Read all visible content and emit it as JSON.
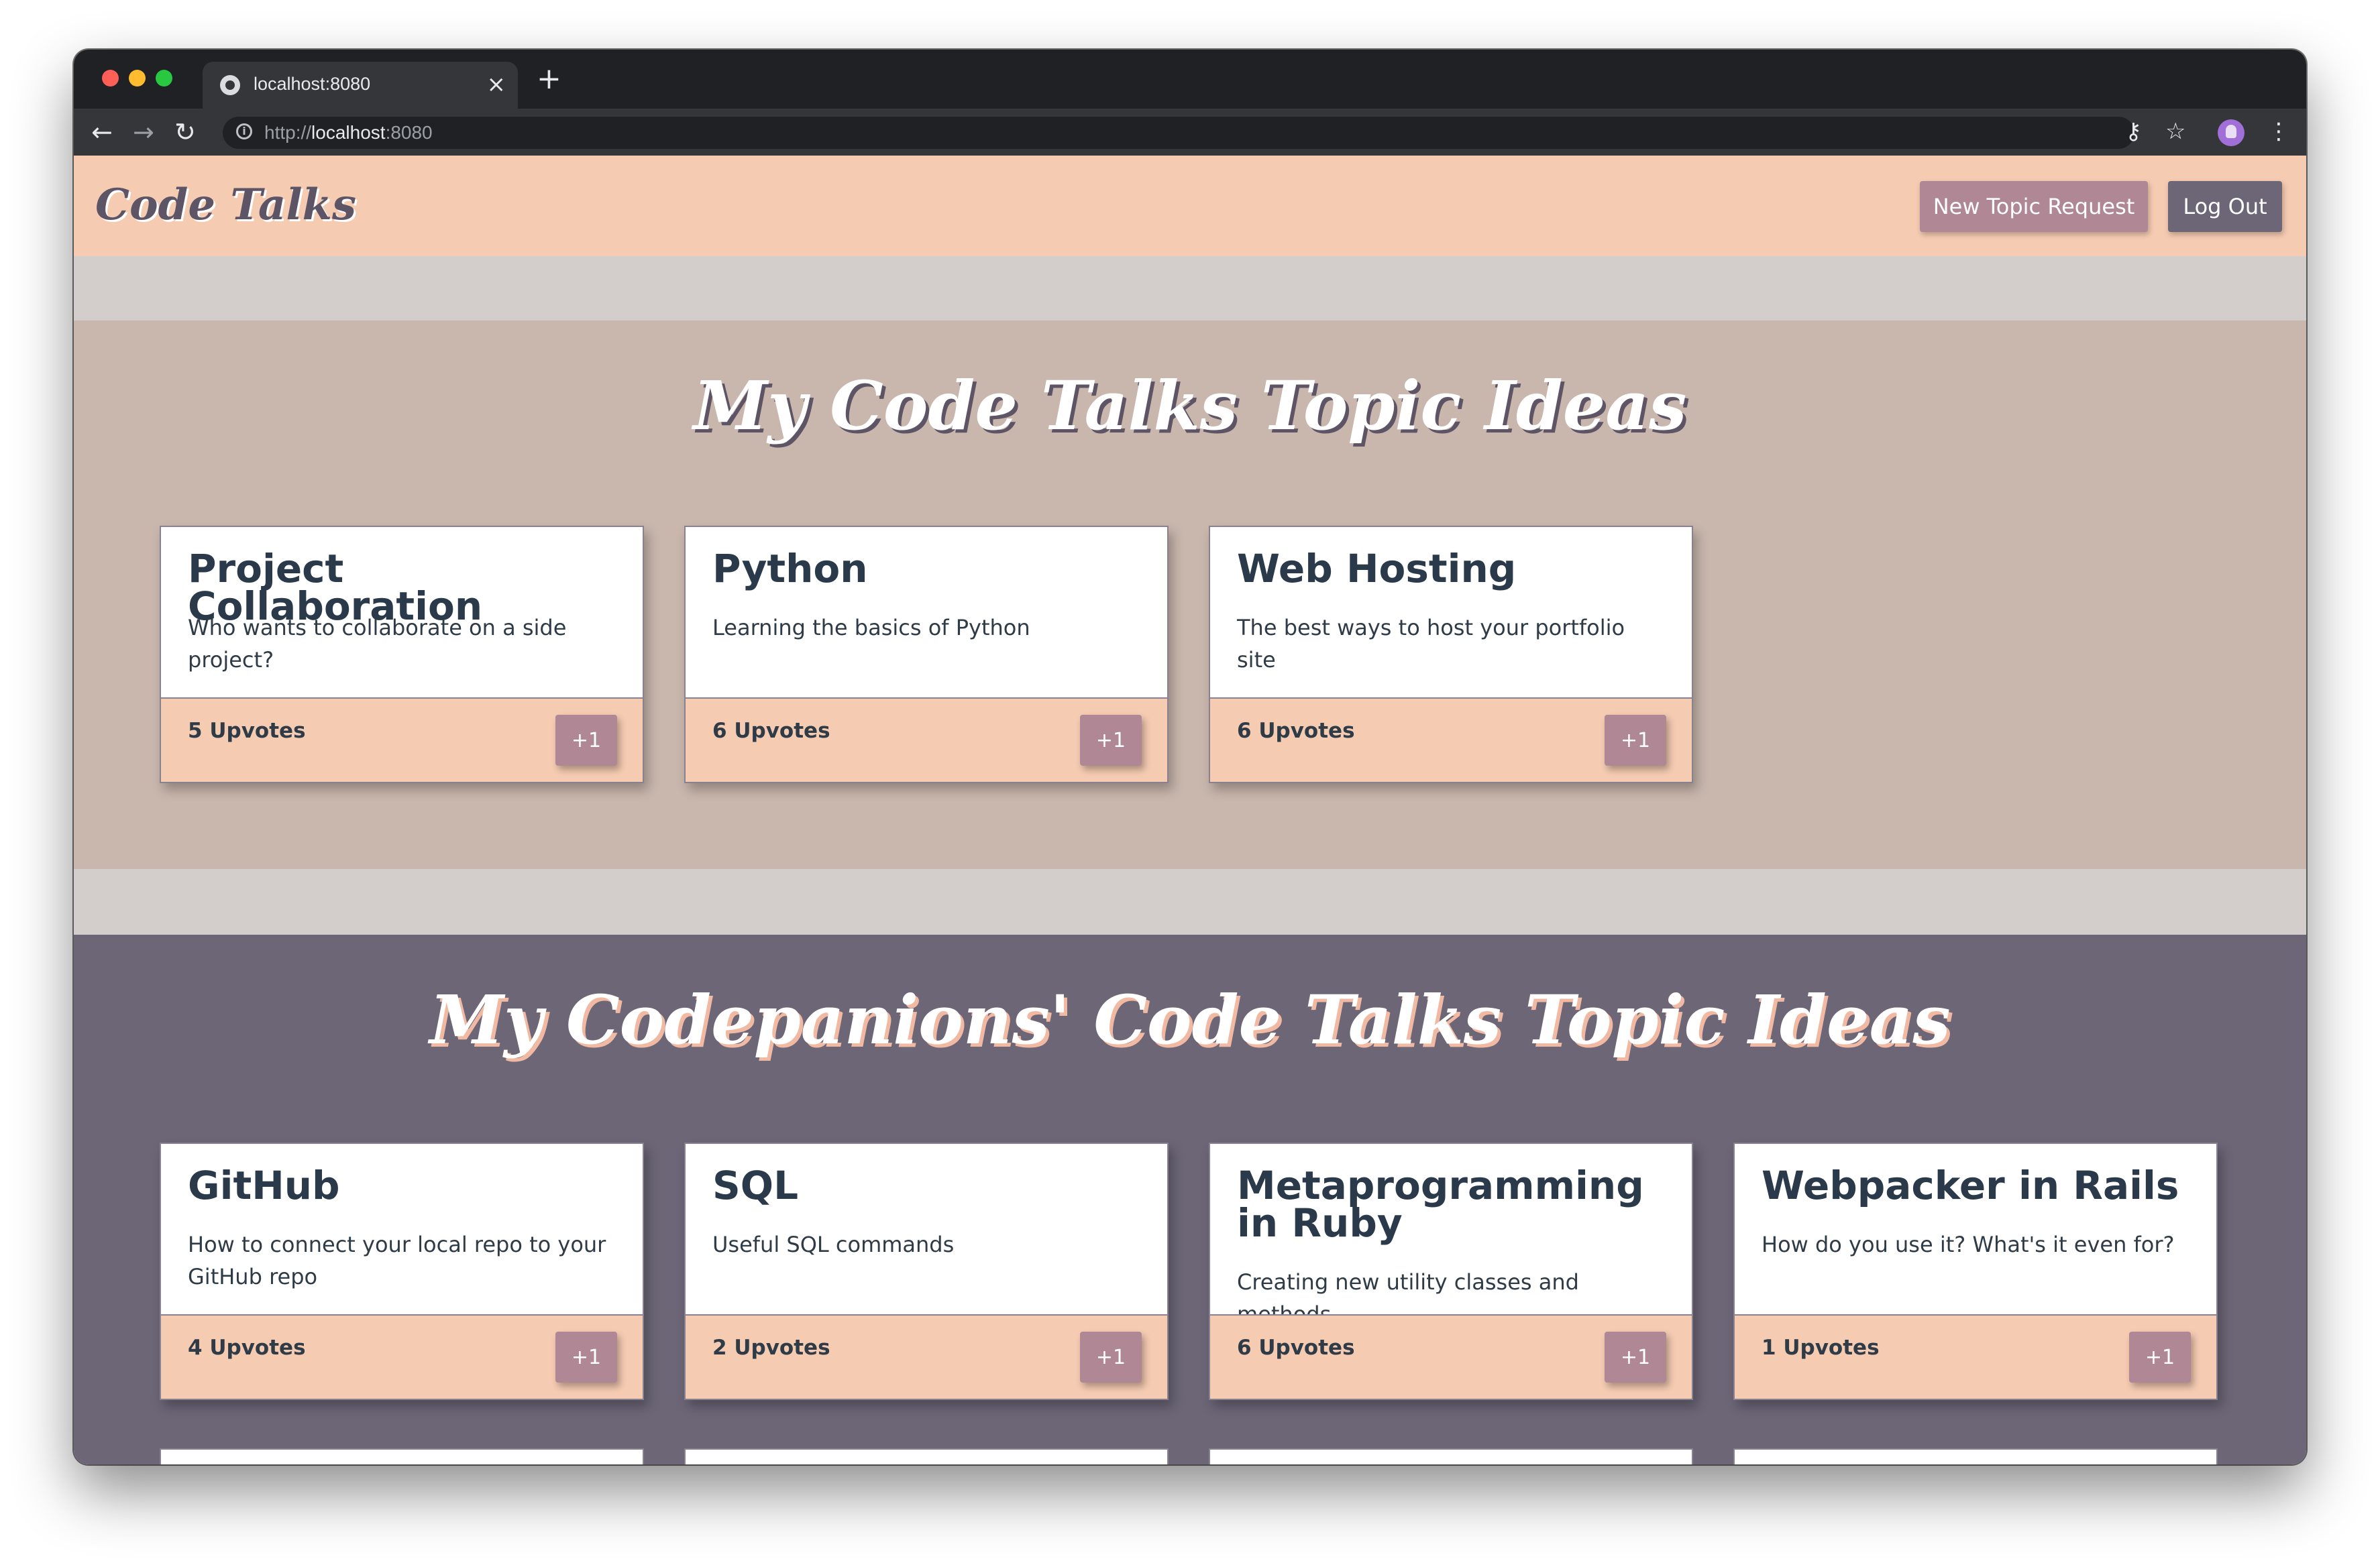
{
  "browser": {
    "tab_title": "localhost:8080",
    "tab_close": "×",
    "new_tab": "+",
    "url_scheme": "http://",
    "url_host": "localhost",
    "url_port": ":8080"
  },
  "header": {
    "logo": "Code Talks",
    "new_topic_label": "New Topic Request",
    "logout_label": "Log Out"
  },
  "my_section": {
    "title": "My Code Talks Topic Ideas",
    "cards": [
      {
        "title": "Project Collaboration",
        "description": "Who wants to collaborate on a side project?",
        "upvotes": "5 Upvotes",
        "button": "+1"
      },
      {
        "title": "Python",
        "description": "Learning the basics of Python",
        "upvotes": "6 Upvotes",
        "button": "+1"
      },
      {
        "title": "Web Hosting",
        "description": "The best ways to host your portfolio site",
        "upvotes": "6 Upvotes",
        "button": "+1"
      }
    ]
  },
  "others_section": {
    "title": "My Codepanions' Code Talks Topic Ideas",
    "cards": [
      {
        "title": "GitHub",
        "description": "How to connect your local repo to your GitHub repo",
        "upvotes": "4 Upvotes",
        "button": "+1"
      },
      {
        "title": "SQL",
        "description": "Useful SQL commands",
        "upvotes": "2 Upvotes",
        "button": "+1"
      },
      {
        "title": "Metaprogramming in Ruby",
        "description": "Creating new utility classes and methods",
        "upvotes": "6 Upvotes",
        "button": "+1"
      },
      {
        "title": "Webpacker in Rails",
        "description": "How do you use it? What's it even for?",
        "upvotes": "1 Upvotes",
        "button": "+1"
      }
    ]
  },
  "colors": {
    "navbar": "#f5cbb2",
    "my_section_bg": "#c9b7ad",
    "others_section_bg": "#6c6677",
    "button_rose": "#b08795",
    "button_slate": "#6c6677"
  }
}
